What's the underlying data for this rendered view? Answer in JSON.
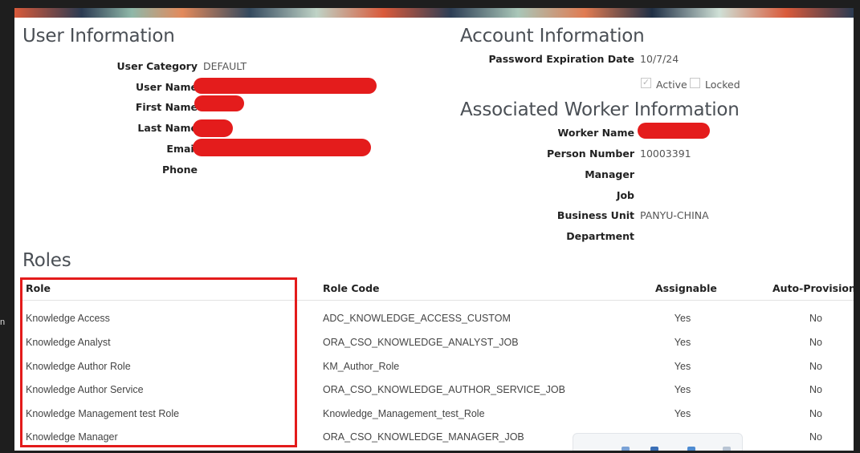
{
  "user_info": {
    "title": "User Information",
    "fields": [
      {
        "label": "User Category",
        "value": "DEFAULT"
      },
      {
        "label": "User Name",
        "value": ""
      },
      {
        "label": "First Name",
        "value": ""
      },
      {
        "label": "Last Name",
        "value": ""
      },
      {
        "label": "Email",
        "value": ""
      },
      {
        "label": "Phone",
        "value": ""
      }
    ]
  },
  "account_info": {
    "title": "Account Information",
    "password_expiration_label": "Password Expiration Date",
    "password_expiration_value": "10/7/24",
    "active_label": "Active",
    "active_checked": true,
    "locked_label": "Locked",
    "locked_checked": false
  },
  "worker_info": {
    "title": "Associated Worker Information",
    "fields": [
      {
        "label": "Worker Name",
        "value": ""
      },
      {
        "label": "Person Number",
        "value": "10003391"
      },
      {
        "label": "Manager",
        "value": ""
      },
      {
        "label": "Job",
        "value": ""
      },
      {
        "label": "Business Unit",
        "value": "PANYU-CHINA"
      },
      {
        "label": "Department",
        "value": ""
      }
    ]
  },
  "roles": {
    "title": "Roles",
    "columns": [
      "Role",
      "Role Code",
      "Assignable",
      "Auto-Provisioned"
    ],
    "rows": [
      {
        "role": "Knowledge Access",
        "code": "ADC_KNOWLEDGE_ACCESS_CUSTOM",
        "assignable": "Yes",
        "auto": "No"
      },
      {
        "role": "Knowledge Analyst",
        "code": "ORA_CSO_KNOWLEDGE_ANALYST_JOB",
        "assignable": "Yes",
        "auto": "No"
      },
      {
        "role": "Knowledge Author Role",
        "code": "KM_Author_Role",
        "assignable": "Yes",
        "auto": "No"
      },
      {
        "role": "Knowledge Author Service",
        "code": "ORA_CSO_KNOWLEDGE_AUTHOR_SERVICE_JOB",
        "assignable": "Yes",
        "auto": "No"
      },
      {
        "role": "Knowledge Management test Role",
        "code": "Knowledge_Management_test_Role",
        "assignable": "Yes",
        "auto": "No"
      },
      {
        "role": "Knowledge Manager",
        "code": "ORA_CSO_KNOWLEDGE_MANAGER_JOB",
        "assignable": "",
        "auto": "No"
      }
    ]
  },
  "colors": {
    "redaction": "#e41c1c",
    "highlight_border": "#e31b1b"
  },
  "left_edge_text": "n"
}
